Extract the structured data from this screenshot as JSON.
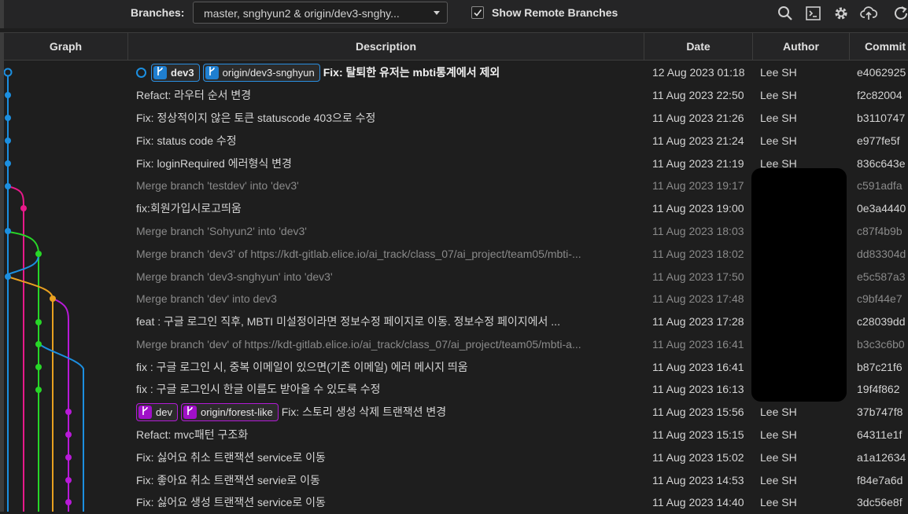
{
  "toolbar": {
    "branches_label": "Branches:",
    "branches_value": "master, snghyun2 & origin/dev3-snghy...",
    "show_remote_label": "Show Remote Branches",
    "show_remote_checked": true
  },
  "columns": {
    "graph": "Graph",
    "description": "Description",
    "date": "Date",
    "author": "Author",
    "commit": "Commit"
  },
  "colors": {
    "blue": "#1c8fe0",
    "pink": "#e8198a",
    "green": "#28d628",
    "orange": "#e8a020",
    "purple": "#b81ad8"
  },
  "rows": [
    {
      "refs_head": true,
      "ref1": "dev3",
      "ref2": "origin/dev3-snghyun",
      "message": "Fix: 탈퇴한 유저는 mbti통계에서 제외",
      "date": "12 Aug 2023 01:18",
      "author": "Lee SH",
      "commit": "e4062925"
    },
    {
      "message": "Refact: 라우터 순서 변경",
      "date": "11 Aug 2023 22:50",
      "author": "Lee SH",
      "commit": "f2c82004"
    },
    {
      "message": "Fix: 정상적이지 않은 토큰 statuscode 403으로 수정",
      "date": "11 Aug 2023 21:26",
      "author": "Lee SH",
      "commit": "b3110747"
    },
    {
      "message": "Fix: status code 수정",
      "date": "11 Aug 2023 21:24",
      "author": "Lee SH",
      "commit": "e977fe5f"
    },
    {
      "message": "Fix: loginRequired 에러형식 변경",
      "date": "11 Aug 2023 21:19",
      "author": "Lee SH",
      "commit": "836c643e"
    },
    {
      "message": "Merge branch 'testdev' into 'dev3'",
      "date": "11 Aug 2023 19:17",
      "author": "",
      "commit": "c591adfa"
    },
    {
      "message": "fix:회원가입시로고띄움",
      "date": "11 Aug 2023 19:00",
      "author": "",
      "commit": "0e3a4440"
    },
    {
      "message": "Merge branch 'Sohyun2' into 'dev3'",
      "date": "11 Aug 2023 18:03",
      "author": "",
      "commit": "c87f4b9b"
    },
    {
      "message": "Merge branch 'dev3' of https://kdt-gitlab.elice.io/ai_track/class_07/ai_project/team05/mbti-...",
      "date": "11 Aug 2023 18:02",
      "author": "",
      "commit": "dd83304d"
    },
    {
      "message": "Merge branch 'dev3-snghyun' into 'dev3'",
      "date": "11 Aug 2023 17:50",
      "author": "",
      "commit": "e5c587a3"
    },
    {
      "message": "Merge branch 'dev' into dev3",
      "date": "11 Aug 2023 17:48",
      "author": "",
      "commit": "c9bf44e7"
    },
    {
      "message": "feat : 구글 로그인 직후, MBTI 미설정이라면 정보수정 페이지로 이동. 정보수정 페이지에서 ...",
      "date": "11 Aug 2023 17:28",
      "author": "",
      "commit": "c28039dd"
    },
    {
      "message": "Merge branch 'dev' of https://kdt-gitlab.elice.io/ai_track/class_07/ai_project/team05/mbti-a...",
      "date": "11 Aug 2023 16:41",
      "author": "",
      "commit": "b3c3c6b0"
    },
    {
      "message": "fix : 구글 로그인 시, 중복 이메일이 있으면(기존 이메일) 에러 메시지 띄움",
      "date": "11 Aug 2023 16:41",
      "author": "",
      "commit": "b87c21f6"
    },
    {
      "message": "fix : 구글 로그인시 한글 이름도 받아올 수 있도록 수정",
      "date": "11 Aug 2023 16:13",
      "author": "",
      "commit": "19f4f862"
    },
    {
      "ref1": "dev",
      "ref2": "origin/forest-like",
      "message": "Fix: 스토리 생성 삭제 트랜잭션 변경",
      "date": "11 Aug 2023 15:56",
      "author": "Lee SH",
      "commit": "37b747f8"
    },
    {
      "message": "Refact: mvc패턴 구조화",
      "date": "11 Aug 2023 15:15",
      "author": "Lee SH",
      "commit": "64311e1f"
    },
    {
      "message": "Fix: 싫어요 취소 트랜잭션 service로 이동",
      "date": "11 Aug 2023 15:02",
      "author": "Lee SH",
      "commit": "a1a12634"
    },
    {
      "message": "Fix: 좋아요 취소 트랜잭션 servie로 이동",
      "date": "11 Aug 2023 14:53",
      "author": "Lee SH",
      "commit": "f84e7a6d"
    },
    {
      "message": "Fix: 싫어요 생성 트랜잭션 service로 이동",
      "date": "11 Aug 2023 14:40",
      "author": "Lee SH",
      "commit": "3dc56e8f"
    }
  ]
}
